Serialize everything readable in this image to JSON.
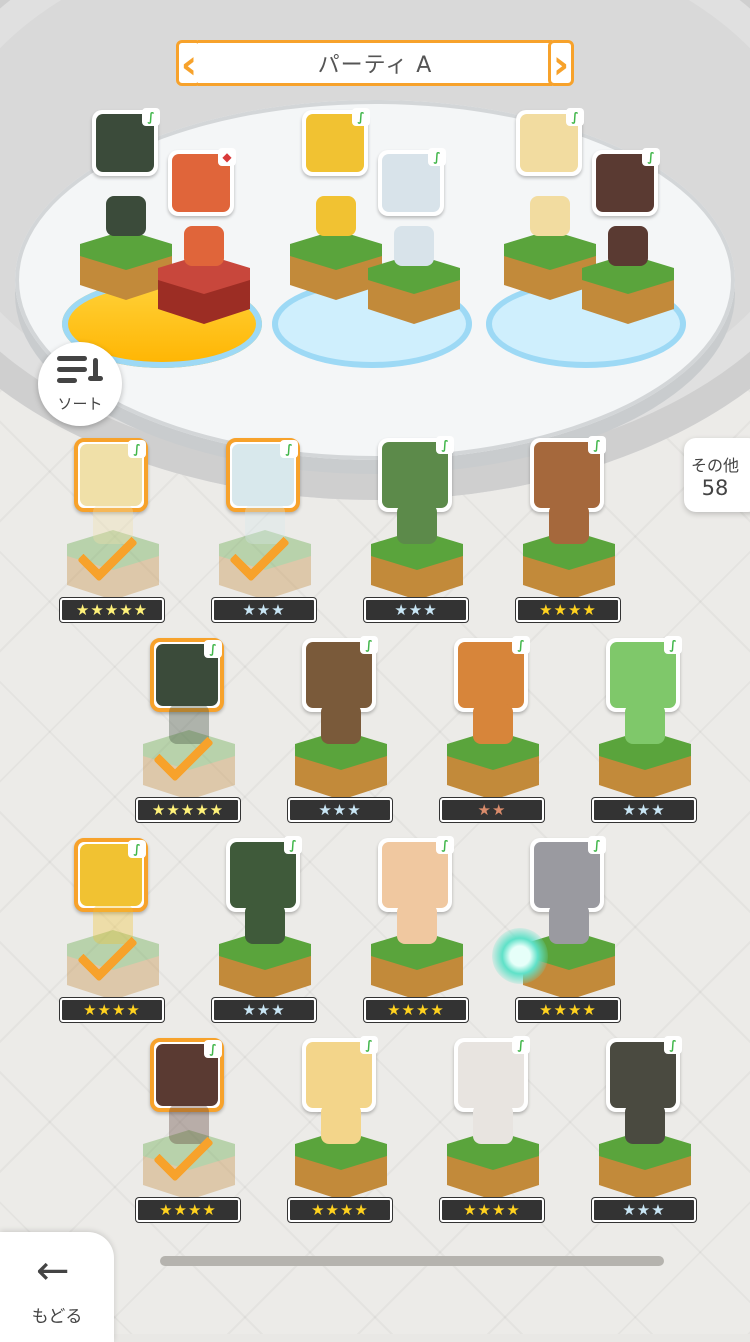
{
  "header": {
    "title": "パーティ A",
    "prev": "‹",
    "next": "›"
  },
  "sort": {
    "label": "ソート"
  },
  "others": {
    "label": "その他",
    "count": "58"
  },
  "back": {
    "label": "もどる",
    "arrow": "←"
  },
  "colors": {
    "accent": "#f7a22b",
    "grass": "#5aa43c",
    "dirt": "#c28a3a",
    "tag_green": "#41b64a",
    "tag_red": "#d83a3a"
  },
  "party": [
    {
      "members": [
        {
          "tag": "leaf-icon",
          "color": "#3b4b3a"
        },
        {
          "tag": "diamond-icon",
          "color": "#e0653a"
        }
      ],
      "pod": "gold"
    },
    {
      "members": [
        {
          "tag": "leaf-icon",
          "color": "#f1c232"
        },
        {
          "tag": "leaf-icon",
          "color": "#d8e3ea"
        }
      ],
      "pod": "blue"
    },
    {
      "members": [
        {
          "tag": "leaf-icon",
          "color": "#f2dca0"
        },
        {
          "tag": "leaf-icon",
          "color": "#5a3a32"
        }
      ],
      "pod": "blue"
    }
  ],
  "tags": {
    "leaf": "∫",
    "diamond": "◆"
  },
  "roster": [
    {
      "stars": "★★★★★",
      "tier": "rainbow",
      "selected": true,
      "color": "#f0e0a8"
    },
    {
      "stars": "★★★",
      "tier": "silver",
      "selected": true,
      "color": "#d8e8ec"
    },
    {
      "stars": "★★★",
      "tier": "silver",
      "selected": false,
      "color": "#5c8a4a"
    },
    {
      "stars": "★★★★",
      "tier": "gold",
      "selected": false,
      "color": "#a5683c"
    },
    {
      "stars": "★★★★★",
      "tier": "rainbow",
      "selected": true,
      "color": "#3b4b3a"
    },
    {
      "stars": "★★★",
      "tier": "silver",
      "selected": false,
      "color": "#7a5a3a"
    },
    {
      "stars": "★★",
      "tier": "bronze",
      "selected": false,
      "color": "#d7853a"
    },
    {
      "stars": "★★★",
      "tier": "silver",
      "selected": false,
      "color": "#7fc86a"
    },
    {
      "stars": "★★★★",
      "tier": "gold",
      "selected": true,
      "color": "#f1c232"
    },
    {
      "stars": "★★★",
      "tier": "silver",
      "selected": false,
      "color": "#3f5a3a"
    },
    {
      "stars": "★★★★",
      "tier": "gold",
      "selected": false,
      "color": "#f0c8a0"
    },
    {
      "stars": "★★★★",
      "tier": "gold",
      "selected": false,
      "color": "#9a9aa0"
    },
    {
      "stars": "★★★★",
      "tier": "gold",
      "selected": true,
      "color": "#5a3a32"
    },
    {
      "stars": "★★★★",
      "tier": "gold",
      "selected": false,
      "color": "#f3d58a"
    },
    {
      "stars": "★★★★",
      "tier": "gold",
      "selected": false,
      "color": "#e8e4e0"
    },
    {
      "stars": "★★★",
      "tier": "silver",
      "selected": false,
      "color": "#4a4a40"
    }
  ]
}
